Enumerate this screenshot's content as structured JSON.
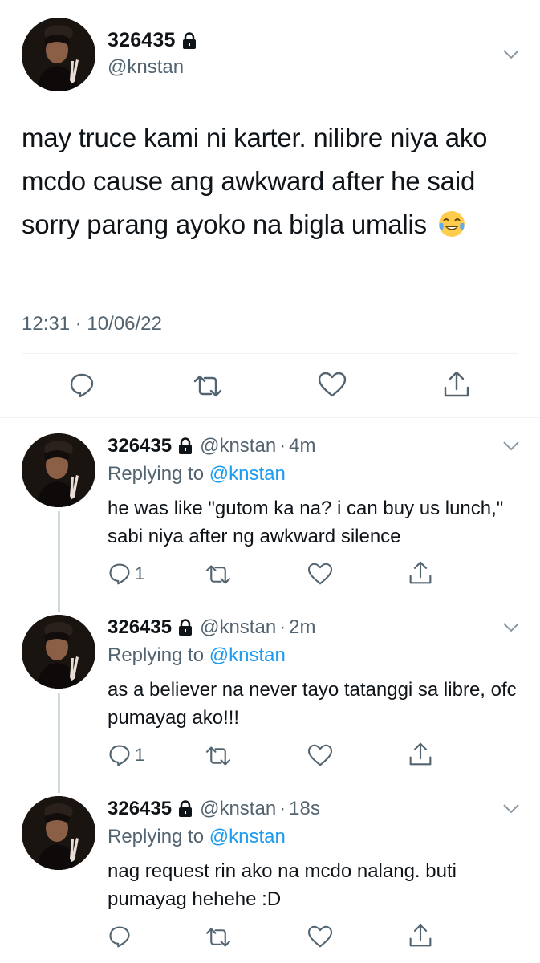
{
  "main": {
    "display_name": "326435",
    "handle": "@knstan",
    "text": "may truce kami ni karter. nilibre niya ako mcdo cause ang awkward after he said sorry parang ayoko na bigla umalis",
    "emoji": "face-with-tears-of-joy",
    "timestamp": "12:31 · 10/06/22"
  },
  "replies": [
    {
      "display_name": "326435",
      "handle": "@knstan",
      "dot": "·",
      "time": "4m",
      "replying_prefix": "Replying to",
      "replying_to": "@knstan",
      "text": "he was like \"gutom ka na? i can buy us lunch,\" sabi niya after ng awkward silence",
      "reply_count": "1"
    },
    {
      "display_name": "326435",
      "handle": "@knstan",
      "dot": "·",
      "time": "2m",
      "replying_prefix": "Replying to",
      "replying_to": "@knstan",
      "text": "as a believer na never tayo tatanggi sa libre, ofc pumayag ako!!!",
      "reply_count": "1"
    },
    {
      "display_name": "326435",
      "handle": "@knstan",
      "dot": "·",
      "time": "18s",
      "replying_prefix": "Replying to",
      "replying_to": "@knstan",
      "text": "nag request rin ako na mcdo nalang. buti pumayag hehehe :D",
      "reply_count": ""
    }
  ],
  "icons": {
    "lock": "lock-icon",
    "caret": "chevron-down-icon",
    "reply": "reply-icon",
    "retweet": "retweet-icon",
    "like": "heart-icon",
    "share": "share-icon"
  },
  "colors": {
    "text": "#0f1419",
    "secondary": "#536471",
    "mention": "#1d9bf0",
    "divider": "#eff3f4",
    "thread_line": "#cfd9de"
  }
}
